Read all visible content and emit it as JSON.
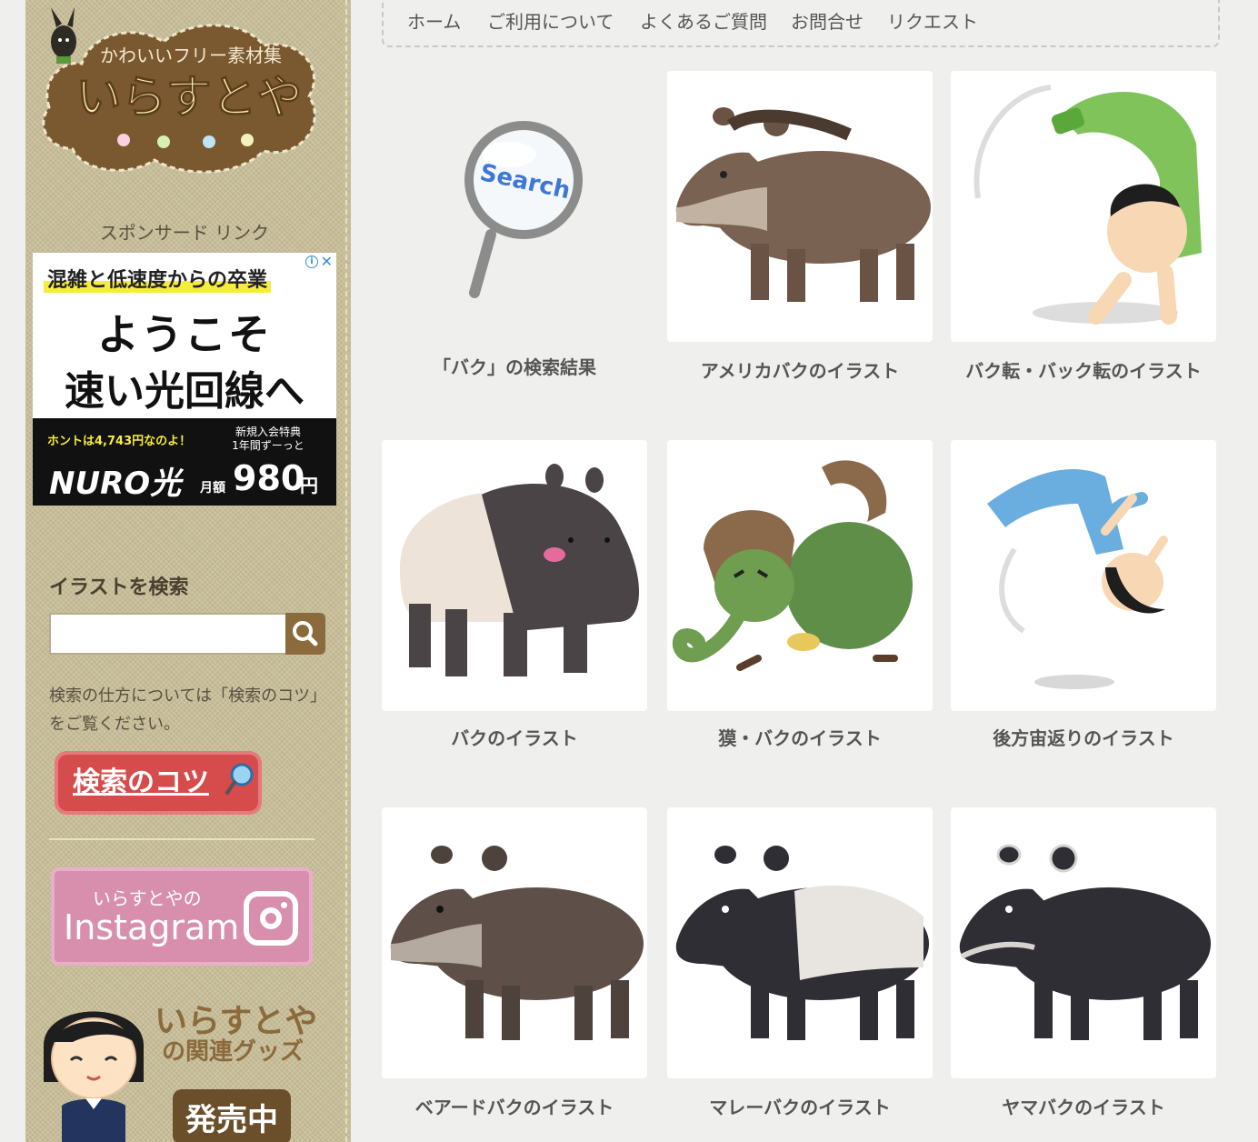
{
  "site": {
    "tagline": "かわいいフリー素材集",
    "name": "いらすとや"
  },
  "sidebar": {
    "sponsor_label": "スポンサード リンク",
    "ad": {
      "headline": "混雑と低速度からの卒業",
      "line1": "ようこそ",
      "line2": "速い光回線へ",
      "note": "ホントは4,743円なのよ！",
      "brand": "NURO光",
      "promo": "新規入会特典\n1年間ずーっと",
      "price_label": "月額",
      "price": "980",
      "price_unit": "円"
    },
    "search_heading": "イラストを検索",
    "search_value": "",
    "search_help": "検索の仕方については「検索のコツ」をご覧ください。",
    "tips_button": "検索のコツ",
    "instagram_small": "いらすとやの",
    "instagram_big": "Instagram",
    "goods_title": "いらすとや",
    "goods_sub": "の関連グッズ",
    "goods_badge": "発売中"
  },
  "nav": [
    "ホーム",
    "ご利用について",
    "よくあるご質問",
    "お問合せ",
    "リクエスト"
  ],
  "search_result_label": "「バク」の検索結果",
  "search_icon_word": "Search",
  "cards": [
    {
      "title": "アメリカバクのイラスト",
      "icon": "american-tapir"
    },
    {
      "title": "バク転・バック転のイラスト",
      "icon": "backflip-boy"
    },
    {
      "title": "バクのイラスト",
      "icon": "malayan-tapir-cute"
    },
    {
      "title": "獏・バクのイラスト",
      "icon": "mythical-baku"
    },
    {
      "title": "後方宙返りのイラスト",
      "icon": "back-somersault"
    },
    {
      "title": "ベアードバクのイラスト",
      "icon": "bairds-tapir"
    },
    {
      "title": "マレーバクのイラスト",
      "icon": "malayan-tapir"
    },
    {
      "title": "ヤマバクのイラスト",
      "icon": "mountain-tapir"
    }
  ]
}
